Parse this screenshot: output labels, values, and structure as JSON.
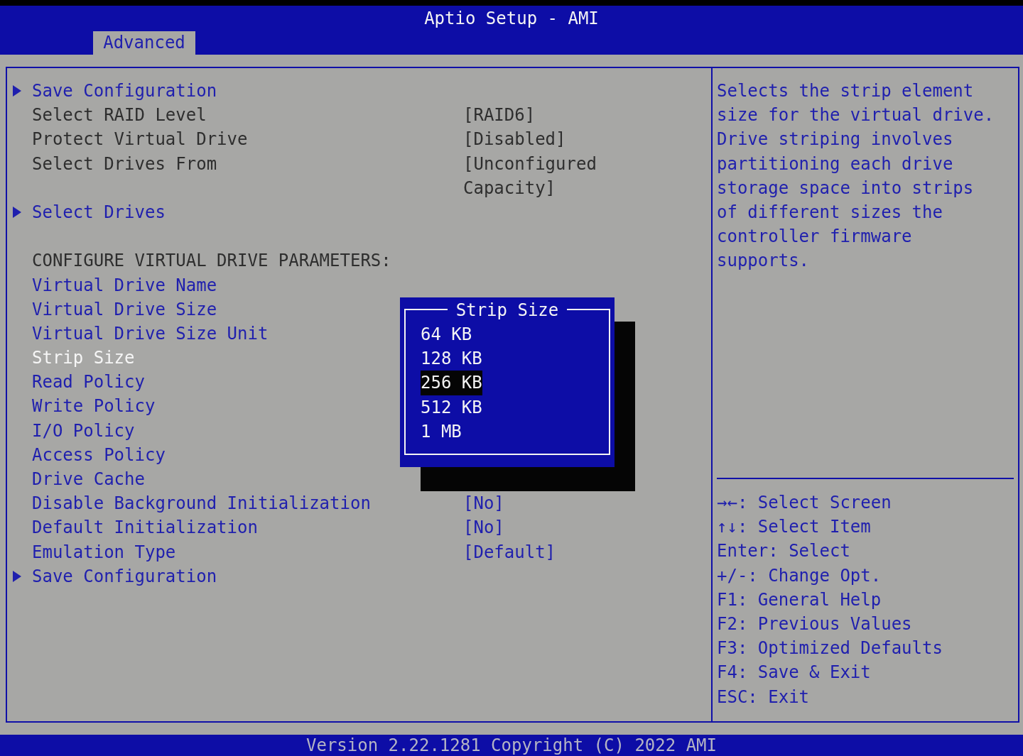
{
  "window": {
    "title": "Aptio Setup - AMI"
  },
  "tabs": [
    {
      "label": "Advanced",
      "selected": true
    }
  ],
  "menu": [
    {
      "kind": "submenu",
      "label": "Save Configuration",
      "selected": false
    },
    {
      "kind": "info",
      "label": "Select RAID Level",
      "value": "[RAID6]",
      "selected": false
    },
    {
      "kind": "info",
      "label": "Protect Virtual Drive",
      "value": "[Disabled]",
      "selected": false
    },
    {
      "kind": "info",
      "label": "Select Drives From",
      "value": "[Unconfigured Capacity]",
      "selected": false
    },
    {
      "kind": "blank"
    },
    {
      "kind": "submenu",
      "label": "Select Drives",
      "selected": false
    },
    {
      "kind": "blank"
    },
    {
      "kind": "heading",
      "label": "CONFIGURE VIRTUAL DRIVE PARAMETERS:"
    },
    {
      "kind": "option",
      "label": "Virtual Drive Name",
      "selected": false
    },
    {
      "kind": "option",
      "label": "Virtual Drive Size",
      "selected": false
    },
    {
      "kind": "option",
      "label": "Virtual Drive Size Unit",
      "selected": false
    },
    {
      "kind": "option",
      "label": "Strip Size",
      "selected": true
    },
    {
      "kind": "option",
      "label": "Read Policy",
      "selected": false
    },
    {
      "kind": "option",
      "label": "Write Policy",
      "selected": false
    },
    {
      "kind": "option",
      "label": "I/O Policy",
      "selected": false
    },
    {
      "kind": "option",
      "label": "Access Policy",
      "selected": false
    },
    {
      "kind": "option",
      "label": "Drive Cache",
      "selected": false
    },
    {
      "kind": "option",
      "label": "Disable Background Initialization",
      "value": "[No]",
      "selected": false
    },
    {
      "kind": "option",
      "label": "Default Initialization",
      "value": "[No]",
      "selected": false
    },
    {
      "kind": "option",
      "label": "Emulation Type",
      "value": "[Default]",
      "selected": false
    },
    {
      "kind": "submenu",
      "label": "Save Configuration",
      "selected": false
    }
  ],
  "popup": {
    "title": "Strip Size",
    "options": [
      {
        "label": "64 KB",
        "selected": false
      },
      {
        "label": "128 KB",
        "selected": false
      },
      {
        "label": "256 KB",
        "selected": true
      },
      {
        "label": "512 KB",
        "selected": false
      },
      {
        "label": "1 MB",
        "selected": false
      }
    ]
  },
  "help_text": "Selects the strip element size for the virtual drive. Drive striping involves partitioning each drive storage space into strips of different sizes the controller firmware supports.",
  "key_help": [
    "→←: Select Screen",
    "↑↓: Select Item",
    "Enter: Select",
    "+/-: Change Opt.",
    "F1: General Help",
    "F2: Previous Values",
    "F3: Optimized Defaults",
    "F4: Save & Exit",
    "ESC: Exit"
  ],
  "status_bar": "Version 2.22.1281 Copyright (C) 2022 AMI"
}
